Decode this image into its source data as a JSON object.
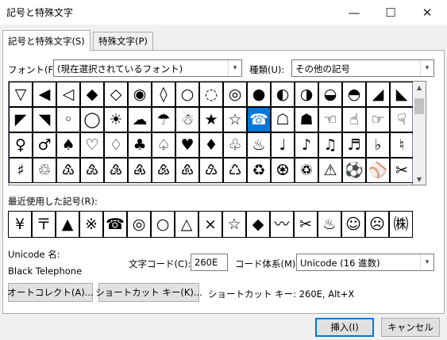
{
  "window": {
    "title": "記号と特殊文字",
    "min_icon": "—",
    "max_icon": "☐",
    "close_icon": "✕"
  },
  "tabs": [
    {
      "label": "記号と特殊文字(S)"
    },
    {
      "label": "特殊文字(P)"
    }
  ],
  "font": {
    "label": "フォント(F):",
    "value": "(現在選択されているフォント)"
  },
  "subset": {
    "label": "種類(U):",
    "value": "その他の記号"
  },
  "symbols": [
    [
      "▽",
      "◀",
      "◁",
      "◆",
      "◇",
      "◉",
      "◊",
      "○",
      "◌",
      "◎",
      "●",
      "◐",
      "◑",
      "◒",
      "◓",
      "◢",
      "◣"
    ],
    [
      "◤",
      "◥",
      "◦",
      "◯",
      "☀",
      "☁",
      "☂",
      "☃",
      "★",
      "☆",
      "☎",
      "☖",
      "☗",
      "☜",
      "☝",
      "☞",
      "☟"
    ],
    [
      "♀",
      "♂",
      "♠",
      "♡",
      "♢",
      "♣",
      "♤",
      "♥",
      "♦",
      "♧",
      "♨",
      "♩",
      "♪",
      "♫",
      "♬",
      "♭",
      "♮"
    ],
    [
      "♯",
      "♲",
      "♳",
      "♴",
      "♵",
      "♶",
      "♷",
      "♸",
      "♹",
      "♺",
      "♻",
      "♼",
      "♽",
      "⚠",
      "⚽",
      "⚾",
      "✂"
    ]
  ],
  "selected": {
    "row": 1,
    "col": 10
  },
  "recent": {
    "label": "最近使用した記号(R):",
    "items": [
      "¥",
      "〒",
      "▲",
      "※",
      "☎",
      "◎",
      "○",
      "△",
      "×",
      "☆",
      "◆",
      "〰",
      "✂",
      "♨",
      "☺",
      "☹",
      "㈱"
    ]
  },
  "unicode_name": {
    "label": "Unicode 名:",
    "value": "Black Telephone"
  },
  "char_code": {
    "label": "文字コード(C):",
    "value": "260E"
  },
  "code_system": {
    "label": "コード体系(M):",
    "value": "Unicode (16 進数)"
  },
  "buttons": {
    "autocorrect": "オートコレクト(A)...",
    "shortcut": "ショートカット キー(K)...",
    "insert": "挿入(I)",
    "cancel": "キャンセル"
  },
  "shortcut_text": "ショートカット キー: 260E, Alt+X",
  "icons": {
    "dropdown": "▾",
    "scroll_up": "▲",
    "scroll_down": "▼"
  }
}
